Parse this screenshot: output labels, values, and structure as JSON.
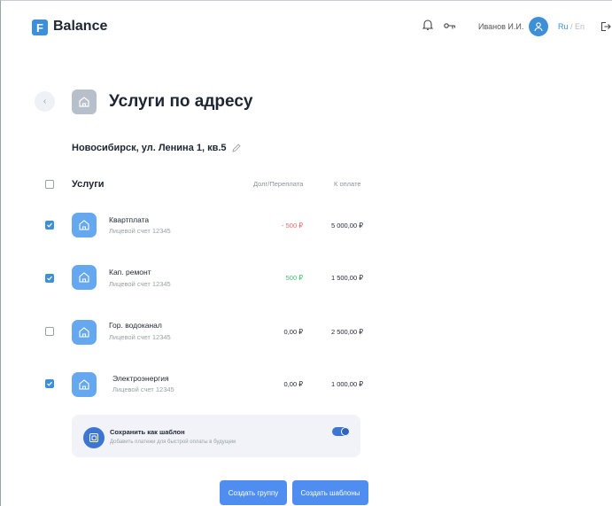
{
  "header": {
    "logo_letter": "F",
    "app_name": "Balance",
    "user_name": "Иванов И.И.",
    "lang_active": "Ru",
    "lang_sep": " / ",
    "lang_inactive": "En",
    "icons": [
      "bell-icon",
      "key-icon",
      "user-icon",
      "logout-icon"
    ]
  },
  "page": {
    "back_glyph": "‹",
    "title": "Услуги по адресу",
    "address": "Новосибирск, ул. Ленина 1, кв.5"
  },
  "table": {
    "header": {
      "services": "Услуги",
      "debt": "Долг/Переплата",
      "to_pay": "К оплате",
      "checked": false
    },
    "rows": [
      {
        "name": "Квартплата",
        "account": "Лицевой счет  12345",
        "debt": "- 500 ₽",
        "debt_type": "negative",
        "to_pay": "5 000,00 ₽",
        "checked": true
      },
      {
        "name": "Кап. ремонт",
        "account": "Лицевой счет  12345",
        "debt": "500 ₽",
        "debt_type": "positive",
        "to_pay": "1 500,00 ₽",
        "checked": true
      },
      {
        "name": "Гор. водоканал",
        "account": "Лицевой счет  12345",
        "debt": "0,00 ₽",
        "debt_type": "zero",
        "to_pay": "2 500,00 ₽",
        "checked": false
      },
      {
        "name": "Электроэнергия",
        "account": "Лицевой счет  12345",
        "debt": "0,00 ₽",
        "debt_type": "zero",
        "to_pay": "1 000,00 ₽",
        "checked": true
      }
    ]
  },
  "template": {
    "title": "Сохранить как шаблон",
    "subtitle": "Добавить платежи для быстрой оплаты в будущем",
    "enabled": true
  },
  "buttons": {
    "create_group": "Создать группу",
    "create_templates": "Создать шаблоны"
  },
  "colors": {
    "accent": "#3d8fd8",
    "negative": "#e46a6a",
    "positive": "#3fbf6d"
  }
}
